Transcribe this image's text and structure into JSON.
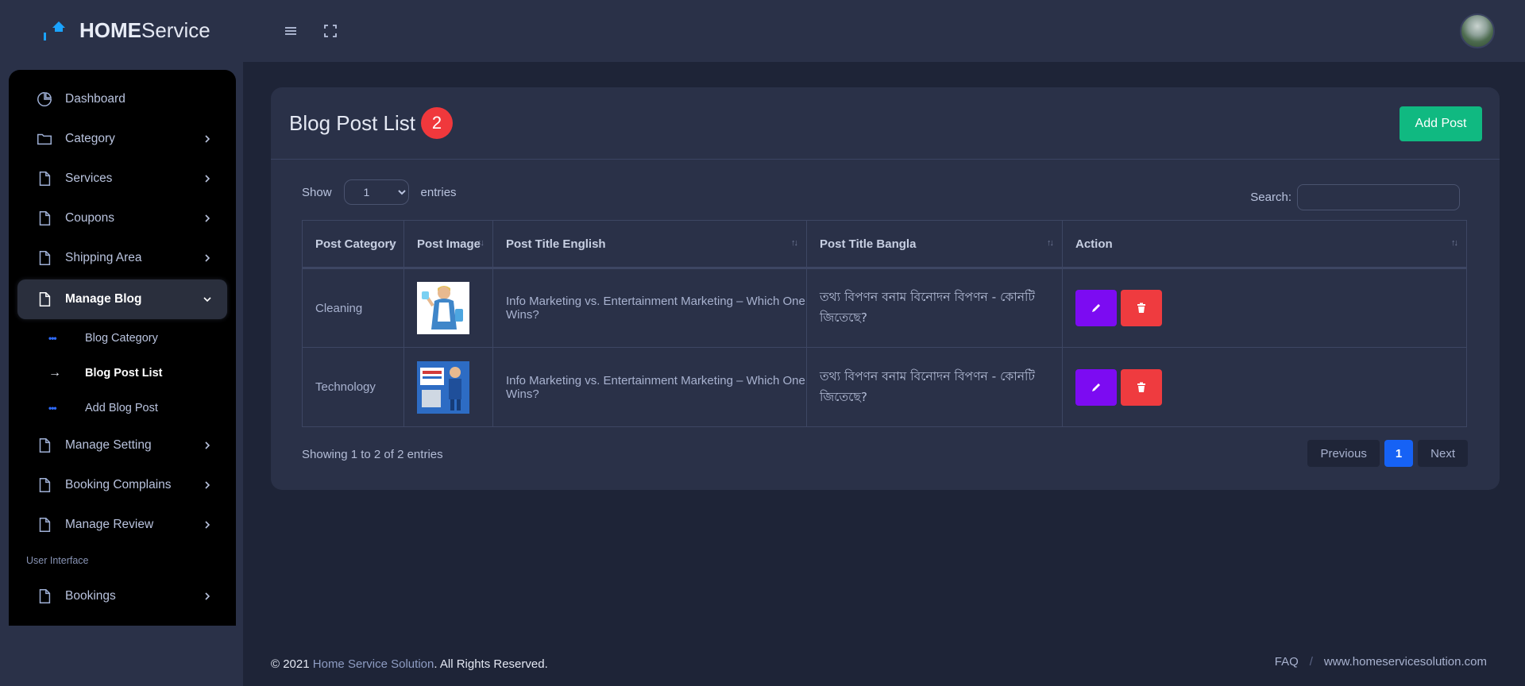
{
  "brand": {
    "bold": "HOME",
    "light": "Service"
  },
  "sidebar": {
    "items": [
      {
        "label": "Dashboard",
        "icon": "pie-chart-icon"
      },
      {
        "label": "Category",
        "icon": "folder-icon"
      },
      {
        "label": "Services",
        "icon": "file-icon"
      },
      {
        "label": "Coupons",
        "icon": "file-icon"
      },
      {
        "label": "Shipping Area",
        "icon": "file-icon"
      },
      {
        "label": "Manage Blog",
        "icon": "file-icon"
      }
    ],
    "blog_sub": [
      {
        "label": "Blog Category"
      },
      {
        "label": "Blog Post List"
      },
      {
        "label": "Add Blog Post"
      }
    ],
    "items2": [
      {
        "label": "Manage Setting"
      },
      {
        "label": "Booking Complains"
      },
      {
        "label": "Manage Review"
      }
    ],
    "heading": "User Interface",
    "items3": [
      {
        "label": "Bookings"
      }
    ]
  },
  "card": {
    "title": "Blog Post List",
    "count": "2",
    "add_label": "Add Post",
    "show_label": "Show",
    "entries_label": "entries",
    "page_size": "1",
    "search_label": "Search:",
    "search_value": ""
  },
  "table": {
    "columns": [
      "Post Category",
      "Post Image",
      "Post Title English",
      "Post Title Bangla",
      "Action"
    ],
    "rows": [
      {
        "category": "Cleaning",
        "image": "cleaning-maid-thumbnail",
        "title_en": "Info Marketing vs. Entertainment Marketing – Which One Wins?",
        "title_bn": "তথ্য বিপণন বনাম বিনোদন বিপণন - কোনটি জিতেছে?"
      },
      {
        "category": "Technology",
        "image": "repair-service-thumbnail",
        "title_en": "Info Marketing vs. Entertainment Marketing – Which One Wins?",
        "title_bn": "তথ্য বিপণন বনাম বিনোদন বিপণন - কোনটি জিতেছে?"
      }
    ]
  },
  "pagination": {
    "info": "Showing 1 to 2 of 2 entries",
    "previous": "Previous",
    "current": "1",
    "next": "Next"
  },
  "footer": {
    "copyright_prefix": "© 2021 ",
    "company": "Home Service Solution",
    "copyright_suffix": ". All Rights Reserved.",
    "faq": "FAQ",
    "separator": "/",
    "website": "www.homeservicesolution.com"
  },
  "colors": {
    "accent_green": "#10b981",
    "badge_red": "#f0383c",
    "edit_purple": "#7c0bf2",
    "delete_red": "#ef3b3f",
    "page_blue": "#1662f5"
  }
}
